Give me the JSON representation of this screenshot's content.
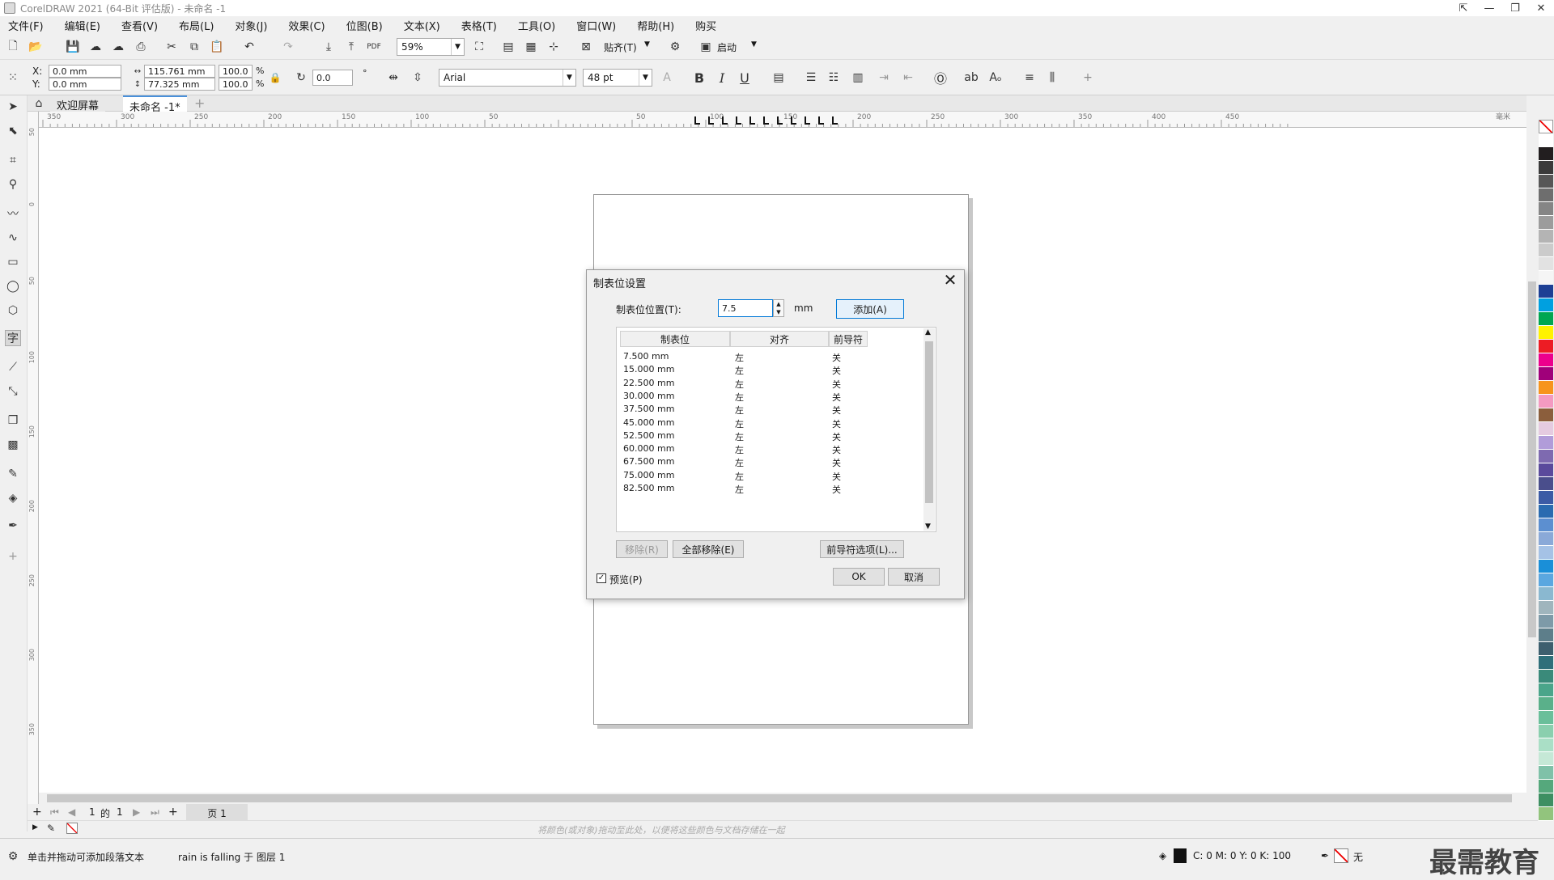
{
  "title": "CorelDRAW 2021 (64-Bit 评估版) - 未命名 -1",
  "menu": [
    "文件(F)",
    "编辑(E)",
    "查看(V)",
    "布局(L)",
    "对象(J)",
    "效果(C)",
    "位图(B)",
    "文本(X)",
    "表格(T)",
    "工具(O)",
    "窗口(W)",
    "帮助(H)",
    "购买"
  ],
  "toolbar": {
    "zoom": "59%",
    "snap": "贴齐(T)",
    "launch": "启动"
  },
  "propbar": {
    "x_label": "X:",
    "x_val": "0.0 mm",
    "y_label": "Y:",
    "y_val": "0.0 mm",
    "w_val": "115.761 mm",
    "h_val": "77.325 mm",
    "sx": "100.0",
    "sy": "100.0",
    "pct": "%",
    "rot": "0.0",
    "deg": "°",
    "font": "Arial",
    "size": "48 pt",
    "bold": "B",
    "italic": "I",
    "underline": "U"
  },
  "tabs": {
    "welcome": "欢迎屏幕",
    "doc": "未命名 -1*",
    "add": "+"
  },
  "ruler_h": [
    "350",
    "300",
    "250",
    "200",
    "150",
    "100",
    "50",
    "",
    "50",
    "100",
    "150",
    "200",
    "250",
    "300",
    "350",
    "400",
    "450"
  ],
  "ruler_h_unit": "毫米",
  "ruler_v": [
    "50",
    "0",
    "50",
    "100",
    "150",
    "200",
    "250",
    "300",
    "350"
  ],
  "dialog": {
    "title": "制表位设置",
    "pos_label": "制表位位置(T):",
    "pos_value": "7.5",
    "unit": "mm",
    "add": "添加(A)",
    "headers": [
      "制表位",
      "对齐",
      "前导符"
    ],
    "rows": [
      [
        "7.500 mm",
        "左",
        "关"
      ],
      [
        "15.000 mm",
        "左",
        "关"
      ],
      [
        "22.500 mm",
        "左",
        "关"
      ],
      [
        "30.000 mm",
        "左",
        "关"
      ],
      [
        "37.500 mm",
        "左",
        "关"
      ],
      [
        "45.000 mm",
        "左",
        "关"
      ],
      [
        "52.500 mm",
        "左",
        "关"
      ],
      [
        "60.000 mm",
        "左",
        "关"
      ],
      [
        "67.500 mm",
        "左",
        "关"
      ],
      [
        "75.000 mm",
        "左",
        "关"
      ],
      [
        "82.500 mm",
        "左",
        "关"
      ]
    ],
    "remove": "移除(R)",
    "remove_all": "全部移除(E)",
    "leader_opts": "前导符选项(L)...",
    "preview": "预览(P)",
    "ok": "OK",
    "cancel": "取消"
  },
  "pagenav": {
    "current": "1",
    "of": "的",
    "total": "1",
    "page_tab": "页 1"
  },
  "doc_palette_hint": "将颜色(或对象)拖动至此处，以便将这些颜色与文档存储在一起",
  "status": {
    "hint": "单击并拖动可添加段落文本",
    "layer": "rain is falling 于 图层 1",
    "cmyk": "C: 0 M: 0 Y: 0 K: 100",
    "none": "无"
  },
  "watermark": "最需教育",
  "palette": [
    "#ffffff",
    "#221e1f",
    "#3a3a3a",
    "#565656",
    "#6e6e6e",
    "#858585",
    "#9c9c9c",
    "#b4b4b4",
    "#cbcbcb",
    "#e2e2e2",
    "#f5f5f5",
    "#1d3f94",
    "#00a0e0",
    "#00a651",
    "#fff200",
    "#ed1c24",
    "#ec008c",
    "#a0007a",
    "#f7941d",
    "#f49ac1",
    "#8b5e3c",
    "#e5cbe0",
    "#b19cd9",
    "#7e6ab0",
    "#5a4a9c",
    "#4a4e8c",
    "#3b5ba5",
    "#2a6bb0",
    "#5c8fd0",
    "#8aa9d8",
    "#a5c2e6",
    "#1a8fd8",
    "#5aa7e0",
    "#8ab8d0",
    "#9fb5bd",
    "#7d9aa8",
    "#5d7e8a",
    "#3d5f6e",
    "#2e6f7a",
    "#3a8a7a",
    "#4aa58a",
    "#5ab08a",
    "#6abf9a",
    "#8acfae",
    "#aadfc6",
    "#c5e8d6",
    "#7fc1a8",
    "#55a87c",
    "#3d8f62",
    "#92c47d"
  ]
}
